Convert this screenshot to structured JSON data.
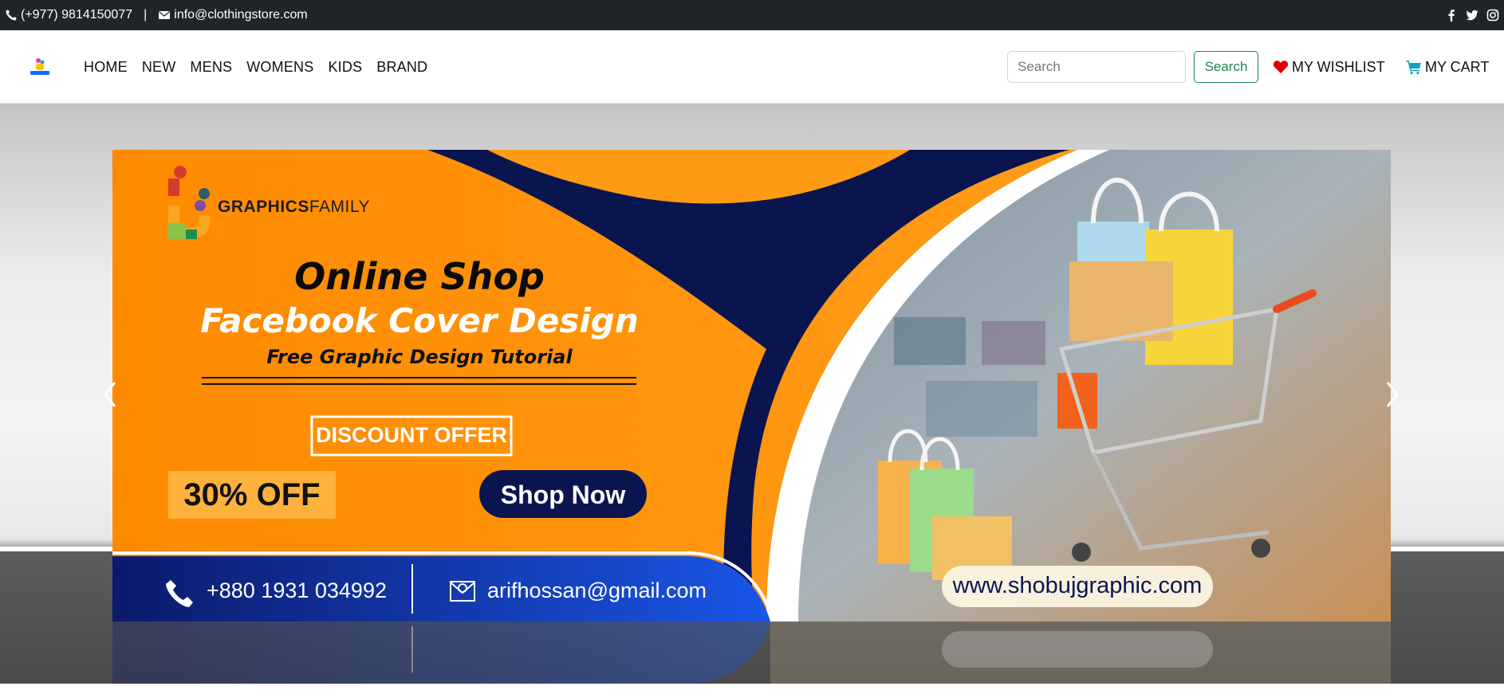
{
  "topbar": {
    "phone": "(+977) 9814150077",
    "separator": "|",
    "email": "info@clothingstore.com",
    "social_icons": [
      "facebook-icon",
      "twitter-icon",
      "instagram-icon"
    ]
  },
  "nav": {
    "links": [
      "HOME",
      "NEW",
      "MENS",
      "WOMENS",
      "KIDS",
      "BRAND"
    ],
    "search_placeholder": "Search",
    "search_button": "Search",
    "wishlist": "MY WISHLIST",
    "cart": "MY CART"
  },
  "banner": {
    "brand_bold": "GRAPHICS",
    "brand_light": "FAMILY",
    "headline": "Online Shop",
    "subheadline": "Facebook Cover Design",
    "tagline": "Free Graphic Design Tutorial",
    "discount": "DISCOUNT OFFER",
    "percent": "30% OFF",
    "cta": "Shop Now",
    "phone": "+880 1931 034992",
    "email": "arifhossan@gmail.com",
    "website": "www.shobujgraphic.com"
  },
  "colors": {
    "topbar_bg": "#212529",
    "orange": "#ff8c00",
    "navy": "#0a1550",
    "blue": "#1345d6",
    "green_button": "#198754",
    "heart": "#e00000",
    "cart_icon": "#17a2b8"
  }
}
